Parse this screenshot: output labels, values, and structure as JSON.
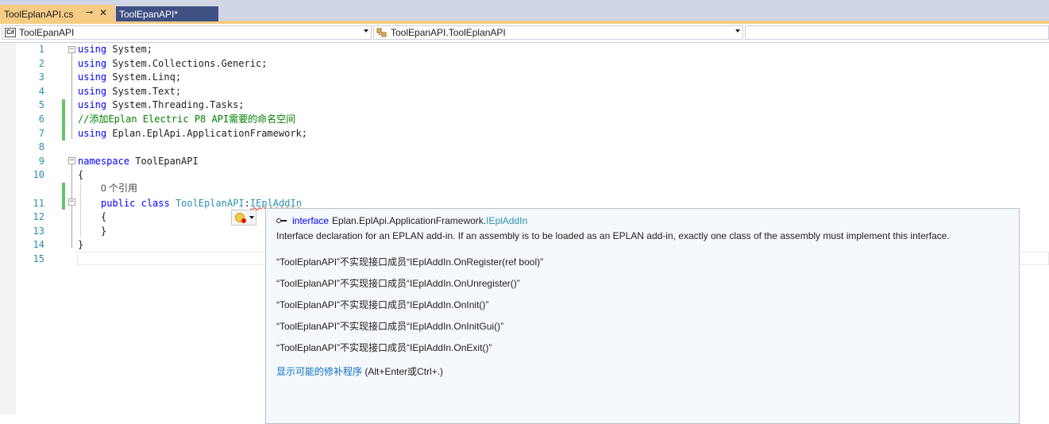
{
  "tabs": [
    {
      "label": "ToolEplanAPI.cs",
      "active": true
    },
    {
      "label": "ToolEpanAPI*",
      "active": false
    }
  ],
  "navbar": {
    "project": "ToolEpanAPI",
    "type": "ToolEpanAPI.ToolEplanAPI",
    "member": ""
  },
  "editor": {
    "line_numbers": [
      "1",
      "2",
      "3",
      "4",
      "5",
      "6",
      "7",
      "8",
      "9",
      "10",
      "",
      "11",
      "12",
      "13",
      "14",
      "15"
    ],
    "lines": {
      "l1": {
        "kw": "using",
        "rest": " System;"
      },
      "l2": {
        "kw": "using",
        "rest": " System.Collections.Generic;"
      },
      "l3": {
        "kw": "using",
        "rest": " System.Linq;"
      },
      "l4": {
        "kw": "using",
        "rest": " System.Text;"
      },
      "l5": {
        "kw": "using",
        "rest": " System.Threading.Tasks;"
      },
      "l6": {
        "comment": "//添加Eplan Electric P8 API需要的命名空间"
      },
      "l7": {
        "kw": "using",
        "rest": " Eplan.EplApi.ApplicationFramework;"
      },
      "l9": {
        "kw": "namespace",
        "rest": " ToolEpanAPI"
      },
      "l10": {
        "text": "{"
      },
      "refs": "0 个引用",
      "l11": {
        "kw1": "public",
        "kw2": "class",
        "cls": "ToolEplanAPI",
        "sep": ":",
        "iface": "IEplAddIn"
      },
      "l12": {
        "text": "{"
      },
      "l13": {
        "text": "}"
      },
      "l14": {
        "text": "}"
      }
    }
  },
  "tooltip": {
    "keyword": "interface",
    "namespace": "Eplan.EplApi.ApplicationFramework.",
    "interface_name": "IEplAddIn",
    "description": "Interface declaration for an EPLAN add-in. If an assembly is to be loaded as an EPLAN add-in, exactly one class of the assembly must implement this interface.",
    "errors": [
      "“ToolEplanAPI”不实现接口成员“IEplAddIn.OnRegister(ref bool)”",
      "“ToolEplanAPI”不实现接口成员“IEplAddIn.OnUnregister()”",
      "“ToolEplanAPI”不实现接口成员“IEplAddIn.OnInit()”",
      "“ToolEplanAPI”不实现接口成员“IEplAddIn.OnInitGui()”",
      "“ToolEplanAPI”不实现接口成员“IEplAddIn.OnExit()”"
    ],
    "fix_link": "显示可能的修补程序",
    "fix_shortcut": " (Alt+Enter或Ctrl+.)"
  }
}
